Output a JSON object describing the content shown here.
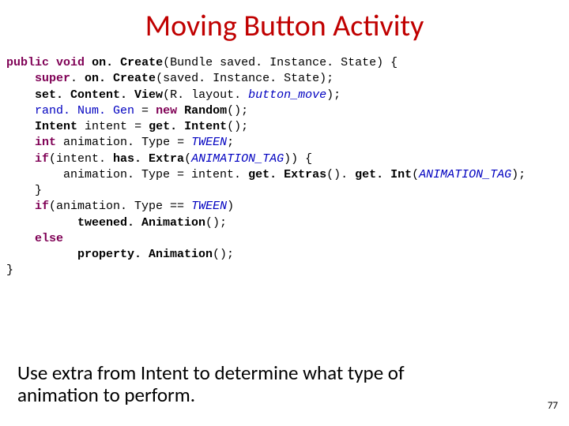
{
  "title": "Moving Button Activity",
  "caption": "Use extra from Intent to determine what type of animation to perform.",
  "page": "77",
  "code": {
    "kw_public": "public",
    "kw_void": "void",
    "kw_super": "super",
    "kw_new": "new",
    "kw_int": "int",
    "kw_if1": "if",
    "kw_if2": "if",
    "kw_else": "else",
    "m_onCreate": "on. Create",
    "m_onCreate2": "on. Create",
    "m_setContent": "set. Content. View",
    "m_random": "Random",
    "m_Intent": "Intent",
    "m_intent": "intent",
    "m_getIntent": "get. Intent",
    "m_animType": "animation. Type",
    "m_hasExtra": "has. Extra",
    "m_getExtras": "get. Extras",
    "m_getInt": "get. Int",
    "m_tweened": "tweened. Animation",
    "m_property": "property. Animation",
    "p_bundle": "Bundle saved. Instance. State",
    "p_saved": "saved. Instance. State",
    "f_rand": "rand. Num. Gen",
    "r_layout": "R. layout.",
    "s_button_move": "button_move",
    "s_tween1": "TWEEN",
    "s_tween2": "TWEEN",
    "s_tag1": "ANIMATION_TAG",
    "s_tag2": "ANIMATION_TAG"
  }
}
